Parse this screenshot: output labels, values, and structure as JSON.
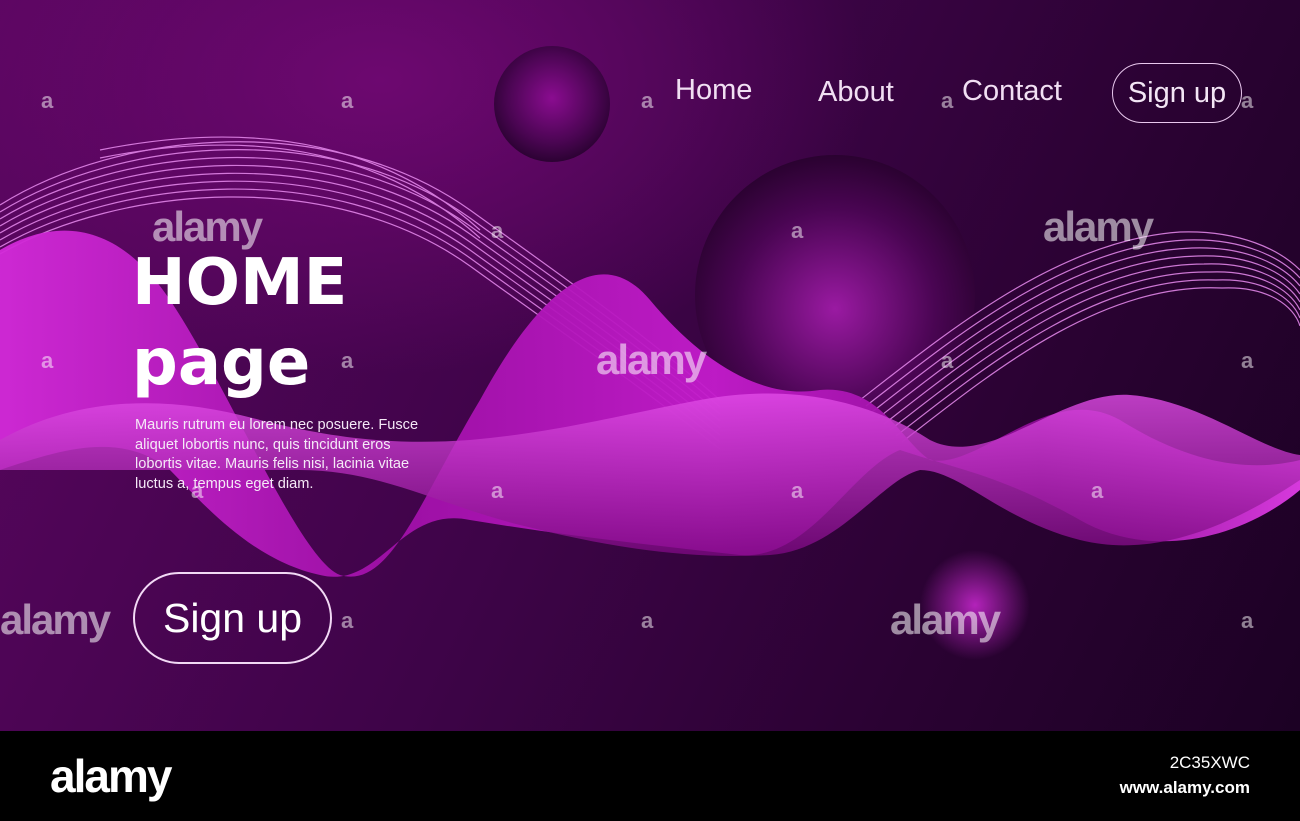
{
  "nav": {
    "home": "Home",
    "about": "About",
    "contact": "Contact",
    "signup": "Sign up"
  },
  "hero": {
    "title_line1": "HOME",
    "title_line2": "page",
    "body": "Mauris rutrum eu lorem nec posuere. Fusce aliquet lobortis nunc, quis tincidunt eros lobortis vitae. Mauris felis nisi, lacinia vitae luctus a, tempus eget diam.",
    "signup": "Sign up"
  },
  "watermark": {
    "brand": "alamy",
    "letter": "a"
  },
  "footer": {
    "logo": "alamy",
    "image_id": "2C35XWC",
    "url": "www.alamy.com"
  },
  "colors": {
    "background_dark": "#2a0232",
    "wave_magenta": "#c21bcc",
    "wave_light": "#f07af5",
    "text": "#ffffff"
  }
}
